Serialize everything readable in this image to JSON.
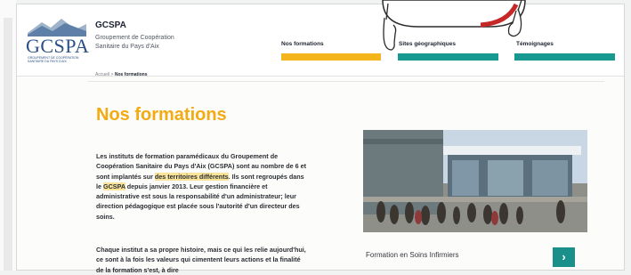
{
  "logo": {
    "text": "GCSPA",
    "sub": "GROUPEMENT DE COOPÉRATION SANITAIRE DU PAYS D'AIX"
  },
  "org": {
    "title": "GCSPA",
    "subtitle": "Groupement de Coopération Sanitaire du Pays d'Aix"
  },
  "nav": [
    {
      "label": "Nos formations",
      "color": "#f4b51c"
    },
    {
      "label": "Sites géographiques",
      "color": "#17998f"
    },
    {
      "label": "Témoignages",
      "color": "#17998f"
    }
  ],
  "breadcrumb": {
    "home": "Accueil",
    "separator": ">",
    "current": "Nos formations"
  },
  "page_title": "Nos formations",
  "paragraph1": {
    "part1": "Les instituts de formation paramédicaux du Groupement de Coopération Sanitaire du Pays d'Aix (GCSPA) sont au nombre de 6 et sont implantés sur ",
    "highlight1": "des territoires différents",
    "part2": ". Ils sont regroupés dans le ",
    "highlight2": "GCSPA",
    "part3": " depuis janvier 2013. Leur gestion financière et administrative est sous la responsabilité d'un administrateur; leur direction pédagogique est placée sous l'autorité d'un directeur des soins."
  },
  "paragraph2": "Chaque institut a sa propre histoire, mais ce qui les relie aujourd'hui, ce sont à la fois les valeurs qui cimentent leurs actions et la finalité de la formation s'est, à dire",
  "formation": {
    "label": "Formation en Soins Infirmiers",
    "button_icon": "chevron-right-icon",
    "button_glyph": "›"
  },
  "colors": {
    "accent_yellow": "#f4b51c",
    "accent_teal": "#17998f",
    "title_orange": "#f2ab12",
    "logo_blue": "#2a4f85"
  }
}
